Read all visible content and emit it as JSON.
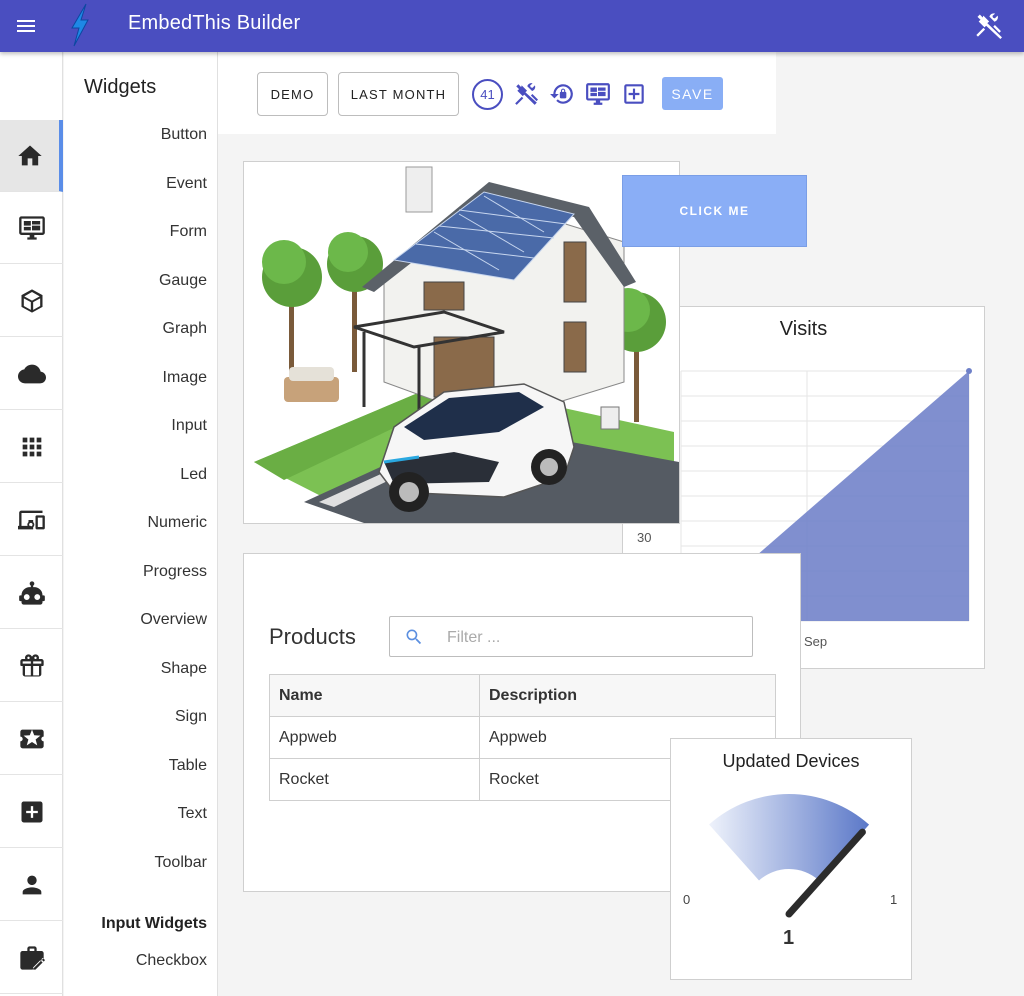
{
  "app": {
    "title": "EmbedThis Builder",
    "accent": "#4a4ec0",
    "icons": {
      "menu": "menu-icon",
      "logo": "lightning-logo",
      "tools": "tools-icon"
    }
  },
  "rail": {
    "items": [
      {
        "icon": "home-icon",
        "active": true
      },
      {
        "icon": "dashboard-monitor-icon"
      },
      {
        "icon": "cube-icon"
      },
      {
        "icon": "cloud-icon"
      },
      {
        "icon": "apps-grid-icon"
      },
      {
        "icon": "devices-icon"
      },
      {
        "icon": "robot-icon"
      },
      {
        "icon": "gift-icon"
      },
      {
        "icon": "ticket-star-icon"
      },
      {
        "icon": "add-box-icon"
      },
      {
        "icon": "person-icon"
      },
      {
        "icon": "briefcase-edit-icon"
      }
    ]
  },
  "palette": {
    "heading": "Widgets",
    "widgets": [
      "Button",
      "Event",
      "Form",
      "Gauge",
      "Graph",
      "Image",
      "Input",
      "Led",
      "Numeric",
      "Progress",
      "Overview",
      "Shape",
      "Sign",
      "Table",
      "Text",
      "Toolbar"
    ],
    "section": "Input Widgets",
    "input_widgets": [
      "Checkbox"
    ]
  },
  "toolbar": {
    "demo_label": "DEMO",
    "range_label": "LAST MONTH",
    "badge": "41",
    "icons": [
      "tools-icon",
      "lock-reset-icon",
      "monitor-dashboard-icon",
      "add-box-icon"
    ],
    "save_label": "SAVE"
  },
  "canvas": {
    "button_label": "CLICK ME",
    "image_alt": "solar-house-with-electric-car",
    "chart_tick_label": "30",
    "products": {
      "title": "Products",
      "filter_placeholder": "Filter ...",
      "columns": [
        "Name",
        "Description"
      ],
      "rows": [
        [
          "Appweb",
          "Appweb"
        ],
        [
          "Rocket",
          "Rocket"
        ]
      ]
    },
    "gauge": {
      "title": "Updated Devices",
      "min_label": "0",
      "max_label": "1",
      "value_label": "1",
      "min": 0,
      "max": 1,
      "value": 1,
      "color": "#5b78c8"
    }
  },
  "chart_data": {
    "type": "area",
    "title": "Visits",
    "x": [
      "",
      "Sep"
    ],
    "series": [
      {
        "values": [
          0,
          100
        ]
      }
    ],
    "ytick_labels": [
      "30"
    ],
    "color": "#6e80c8",
    "grid": true
  }
}
